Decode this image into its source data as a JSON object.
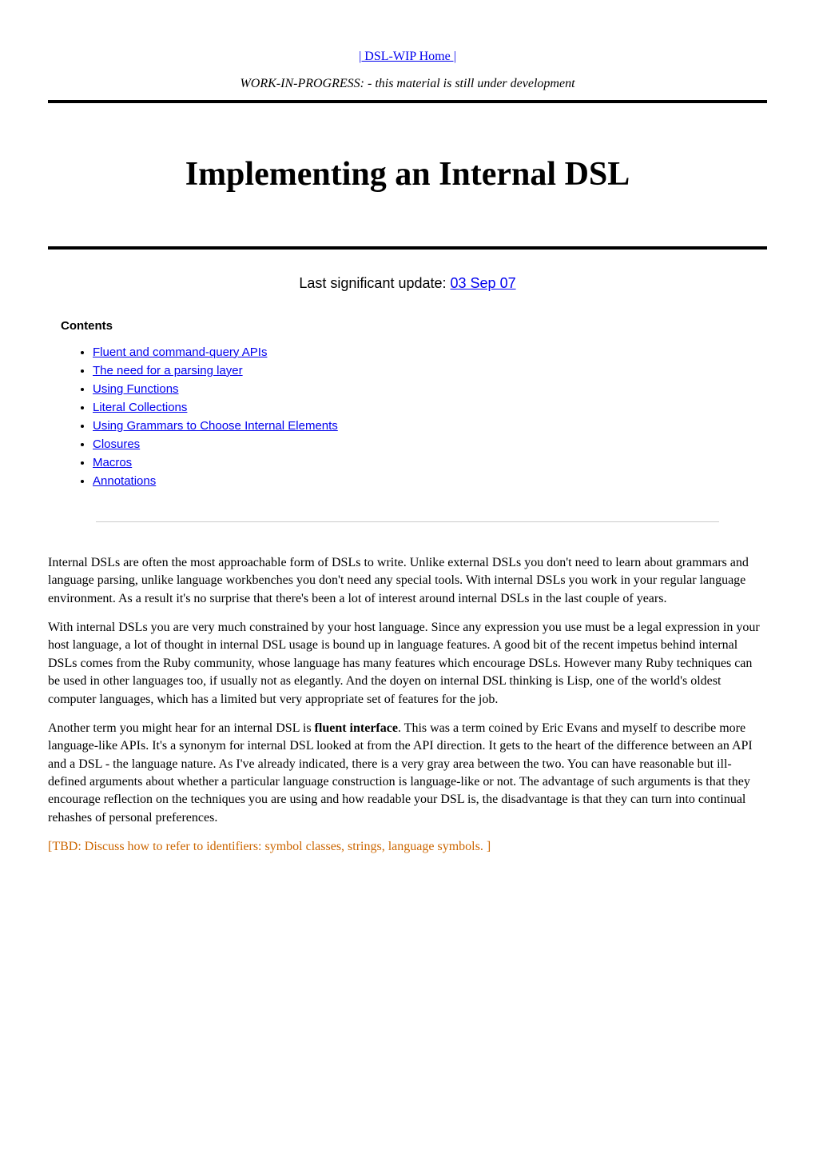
{
  "nav": {
    "home_link": "| DSL-WIP Home |"
  },
  "wip_notice": "WORK-IN-PROGRESS: - this material is still under development",
  "title": "Implementing an Internal DSL",
  "update": {
    "prefix": "Last significant update: ",
    "date": "03 Sep 07"
  },
  "contents": {
    "header": "Contents",
    "items": [
      "Fluent and command-query APIs",
      "The need for a parsing layer",
      "Using Functions",
      "Literal Collections",
      "Using Grammars to Choose Internal Elements",
      "Closures",
      "Macros",
      "Annotations"
    ]
  },
  "paragraphs": {
    "p1": "Internal DSLs are often the most approachable form of DSLs to write. Unlike external DSLs you don't need to learn about grammars and language parsing, unlike language workbenches you don't need any special tools. With internal DSLs you work in your regular language environment. As a result it's no surprise that there's been a lot of interest around internal DSLs in the last couple of years.",
    "p2": "With internal DSLs you are very much constrained by your host language. Since any expression you use must be a legal expression in your host language, a lot of thought in internal DSL usage is bound up in language features. A good bit of the recent impetus behind internal DSLs comes from the Ruby community, whose language has many features which encourage DSLs. However many Ruby techniques can be used in other languages too, if usually not as elegantly. And the doyen on internal DSL thinking is Lisp, one of the world's oldest computer languages, which has a limited but very appropriate set of features for the job.",
    "p3_pre": "Another term you might hear for an internal DSL is ",
    "p3_bold": "fluent interface",
    "p3_post": ". This was a term coined by Eric Evans and myself to describe more language-like APIs. It's a synonym for internal DSL looked at from the API direction. It gets to the heart of the difference between an API and a DSL - the language nature. As I've already indicated, there is a very gray area between the two. You can have reasonable but ill-defined arguments about whether a particular language construction is language-like or not. The advantage of such arguments is that they encourage reflection on the techniques you are using and how readable your DSL is, the disadvantage is that they can turn into continual rehashes of personal preferences.",
    "tbd": "[TBD: Discuss how to refer to identifiers: symbol classes, strings, language symbols. ]"
  }
}
